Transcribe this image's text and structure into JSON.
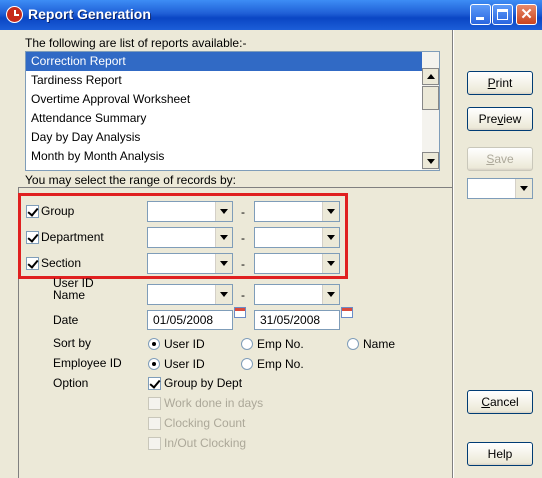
{
  "window": {
    "title": "Report Generation"
  },
  "reports": {
    "label": "The following are list of reports available:-",
    "items": [
      {
        "label": "Correction Report",
        "selected": true
      },
      {
        "label": "Tardiness Report",
        "selected": false
      },
      {
        "label": "Overtime Approval Worksheet",
        "selected": false
      },
      {
        "label": "Attendance Summary",
        "selected": false
      },
      {
        "label": "Day by Day Analysis",
        "selected": false
      },
      {
        "label": "Month by Month Analysis",
        "selected": false
      }
    ]
  },
  "range": {
    "label": "You may select the range of records by:",
    "group": {
      "label": "Group",
      "checked": true,
      "from": "",
      "to": ""
    },
    "department": {
      "label": "Department",
      "checked": true,
      "from": "",
      "to": ""
    },
    "section": {
      "label": "Section",
      "checked": true,
      "from": "",
      "to": ""
    },
    "user_id_name": {
      "label_line1": "User ID",
      "label_line2": "Name",
      "from": "",
      "to": ""
    },
    "separator": "-",
    "date": {
      "label": "Date",
      "from": "01/05/2008",
      "to": "31/05/2008"
    },
    "sort_by": {
      "label": "Sort by",
      "options": [
        "User ID",
        "Emp No.",
        "Name"
      ],
      "selected": "User ID"
    },
    "employee_id": {
      "label": "Employee ID",
      "options": [
        "User ID",
        "Emp No."
      ],
      "selected": "User ID"
    },
    "option": {
      "label": "Option",
      "items": [
        {
          "label": "Group by Dept",
          "checked": true,
          "enabled": true
        },
        {
          "label": "Work done in days",
          "checked": false,
          "enabled": false
        },
        {
          "label": "Clocking Count",
          "checked": false,
          "enabled": false
        },
        {
          "label": "In/Out Clocking",
          "checked": false,
          "enabled": false
        }
      ]
    }
  },
  "buttons": {
    "print": {
      "pre": "",
      "key": "P",
      "post": "rint"
    },
    "preview": {
      "pre": "Pre",
      "key": "v",
      "post": "iew"
    },
    "save": {
      "pre": "",
      "key": "S",
      "post": "ave"
    },
    "cancel": {
      "pre": "",
      "key": "C",
      "post": "ancel"
    },
    "help": {
      "label": "Help"
    }
  },
  "colors": {
    "titlebar": "#0a46c4",
    "selection": "#316ac5",
    "highlight_box": "#e02020"
  }
}
